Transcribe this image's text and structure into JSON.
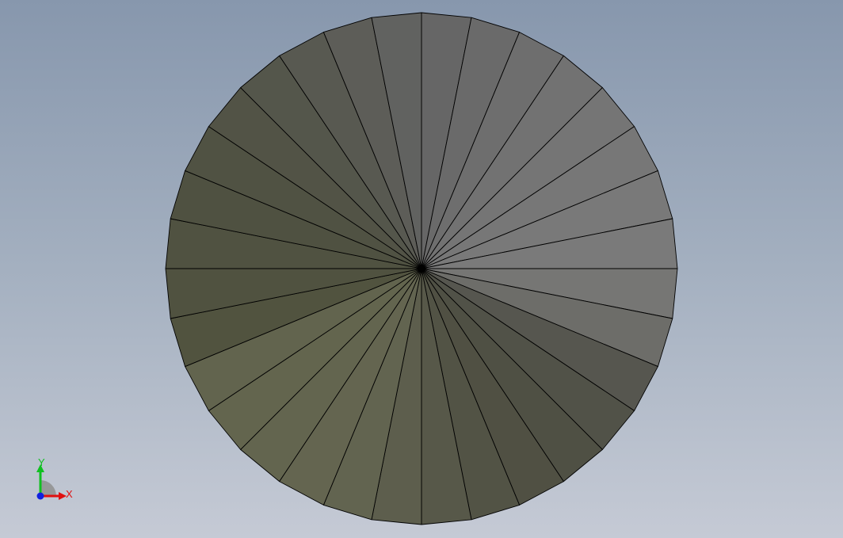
{
  "viewport": {
    "background_top": "#8797ad",
    "background_bottom": "#c5cad5"
  },
  "model": {
    "shape": "cone-top-view",
    "segment_count": 32,
    "edge_color": "#000000"
  },
  "triad": {
    "x_label": "X",
    "y_label": "Y",
    "x_color": "#e01010",
    "y_color": "#10c020",
    "z_color": "#1020e0"
  }
}
